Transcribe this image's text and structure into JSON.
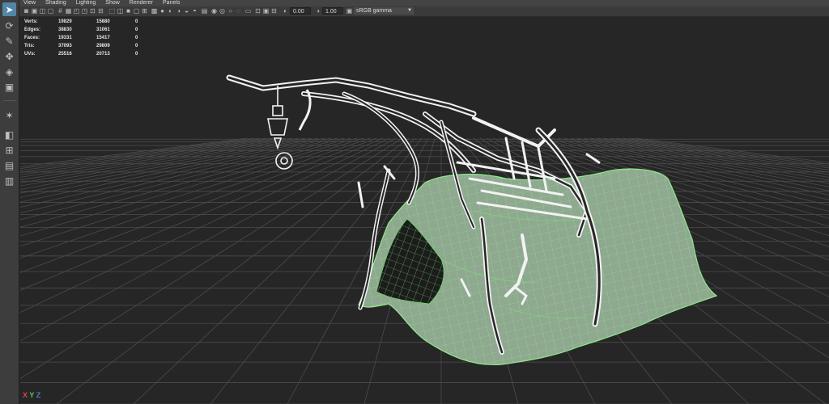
{
  "menu": {
    "items": [
      "View",
      "Shading",
      "Lighting",
      "Show",
      "Renderer",
      "Panels"
    ]
  },
  "toolbar": {
    "camera_near": "0.00",
    "exposure": "1.00",
    "color_space": "sRGB gamma"
  },
  "hud": {
    "rows": [
      {
        "label": "Verts:",
        "v1": "19829",
        "v2": "15880",
        "v3": "0"
      },
      {
        "label": "Edges:",
        "v1": "38830",
        "v2": "31061",
        "v3": "0"
      },
      {
        "label": "Faces:",
        "v1": "19331",
        "v2": "15417",
        "v3": "0"
      },
      {
        "label": "Tris:",
        "v1": "37093",
        "v2": "29809",
        "v3": "0"
      },
      {
        "label": "UVs:",
        "v1": "25516",
        "v2": "20713",
        "v3": "0"
      }
    ]
  },
  "axis": {
    "x": "X",
    "y": "Y",
    "z": "Z"
  },
  "colors": {
    "toolbox": "#3d3d3d",
    "viewport": "#262626",
    "grid": "#505050",
    "wire": "#f2f2f2",
    "cloth_fill": "#8fa890",
    "cloth_wire": "#8fe98a",
    "active_tool": "#5285a6"
  },
  "icons": {
    "tools": [
      "select-arrow-icon",
      "lasso-icon",
      "paint-select-icon",
      "move-icon",
      "rotate-icon",
      "scale-icon",
      "last-tool-icon",
      "soft-select-icon",
      "single-pane-icon",
      "four-pane-icon",
      "two-pane-icon",
      "outliner-pane-icon"
    ]
  }
}
